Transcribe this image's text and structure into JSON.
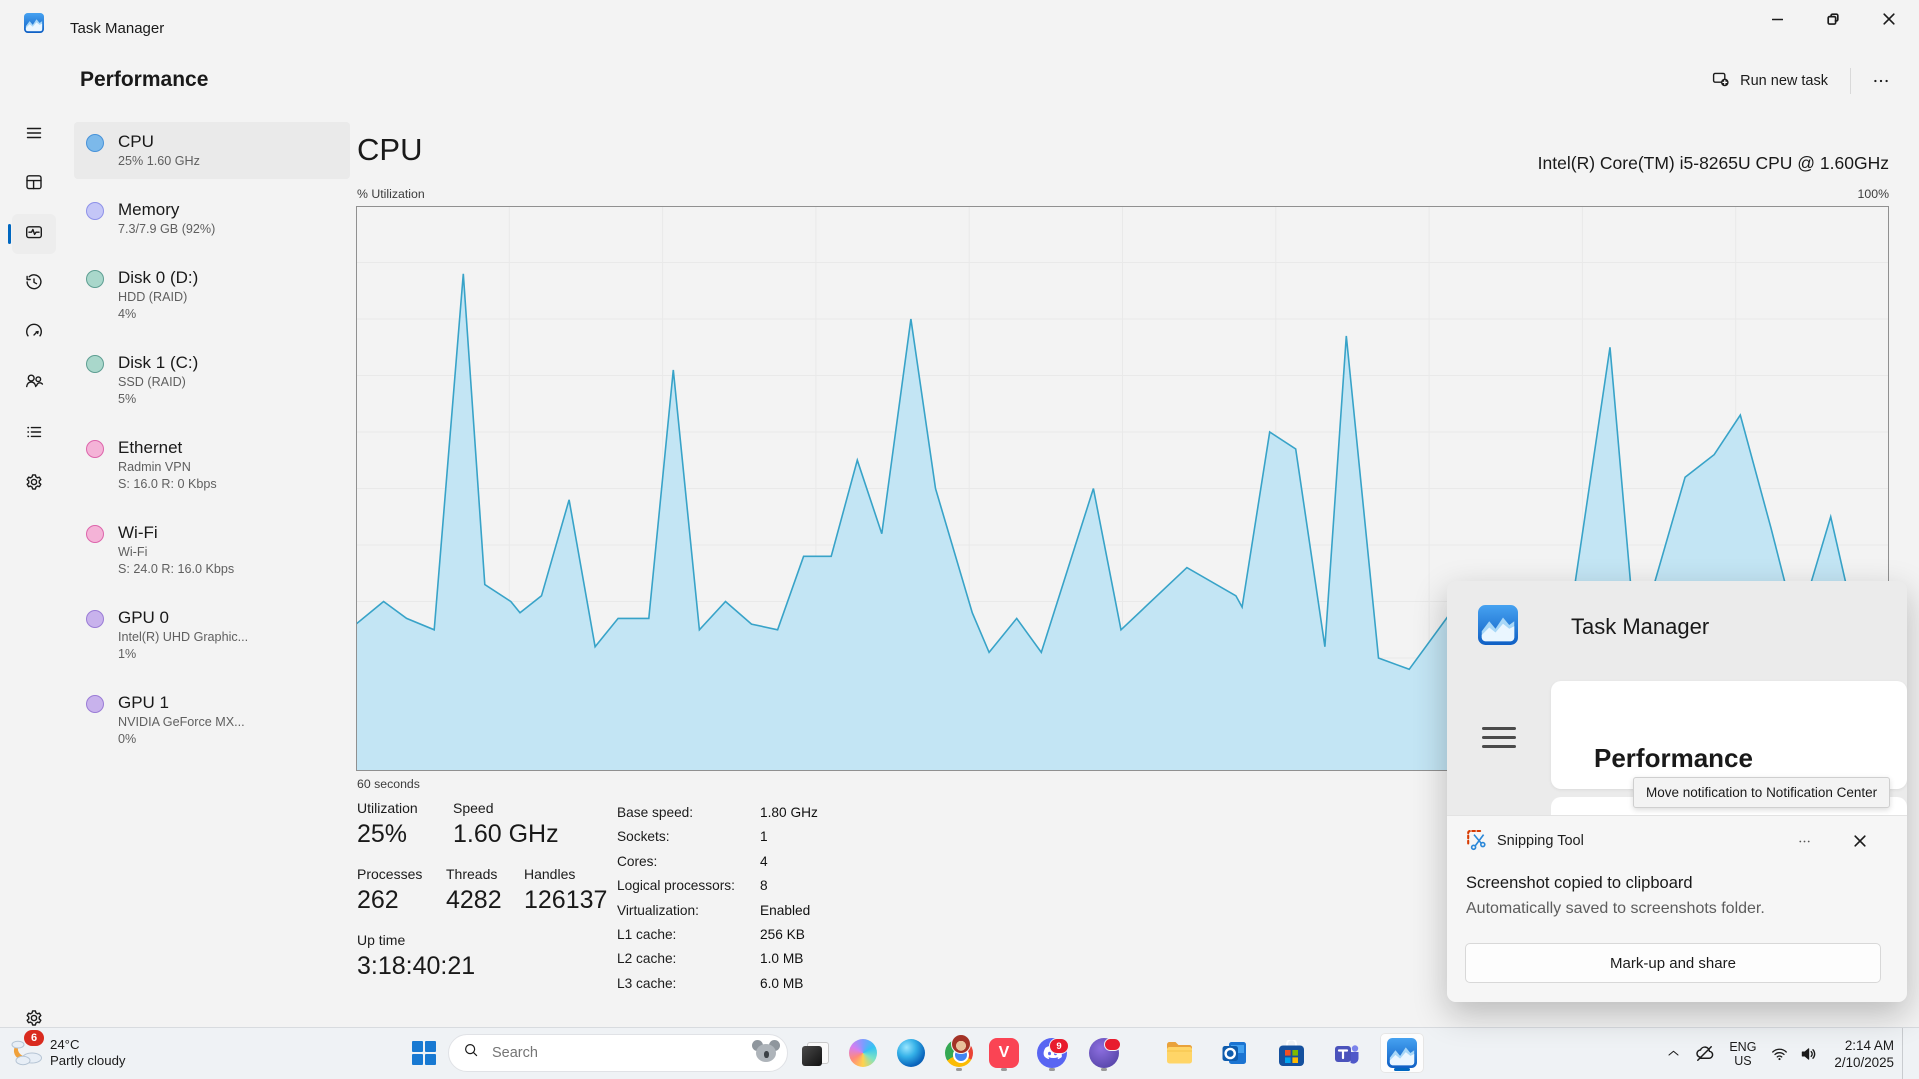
{
  "accent": "#0067c0",
  "window": {
    "title": "Task Manager"
  },
  "header": {
    "title": "Performance",
    "run_new_task": "Run new task"
  },
  "rail": {
    "items": [
      {
        "id": "hamburger",
        "name": "navigation-menu"
      },
      {
        "id": "processes",
        "name": "processes"
      },
      {
        "id": "performance",
        "name": "performance",
        "selected": true
      },
      {
        "id": "app-history",
        "name": "app-history"
      },
      {
        "id": "startup-apps",
        "name": "startup-apps"
      },
      {
        "id": "users",
        "name": "users"
      },
      {
        "id": "details",
        "name": "details"
      },
      {
        "id": "services",
        "name": "services"
      }
    ],
    "bottom": {
      "id": "settings",
      "name": "settings"
    }
  },
  "sidebar": {
    "items": [
      {
        "name": "CPU",
        "line2": "25% 1.60 GHz",
        "color": "cpu",
        "selected": true
      },
      {
        "name": "Memory",
        "line2": "7.3/7.9 GB (92%)",
        "color": "memory"
      },
      {
        "name": "Disk 0 (D:)",
        "line2": "HDD (RAID)",
        "line3": "4%",
        "color": "disk"
      },
      {
        "name": "Disk 1 (C:)",
        "line2": "SSD (RAID)",
        "line3": "5%",
        "color": "disk"
      },
      {
        "name": "Ethernet",
        "line2": "Radmin VPN",
        "line3": "S: 16.0 R: 0 Kbps",
        "color": "net"
      },
      {
        "name": "Wi-Fi",
        "line2": "Wi-Fi",
        "line3": "S: 24.0 R: 16.0 Kbps",
        "color": "net"
      },
      {
        "name": "GPU 0",
        "line2": "Intel(R) UHD Graphic...",
        "line3": "1%",
        "color": "gpu"
      },
      {
        "name": "GPU 1",
        "line2": "NVIDIA GeForce MX...",
        "line3": "0%",
        "color": "gpu"
      }
    ],
    "colors": {
      "cpu": {
        "fill": "#7cb9ea",
        "stroke": "#4792d9"
      },
      "memory": {
        "fill": "#c4c6f7",
        "stroke": "#8e91e9"
      },
      "disk": {
        "fill": "#a9d7cb",
        "stroke": "#5d9e92"
      },
      "net": {
        "fill": "#f4b3d7",
        "stroke": "#dd64ab"
      },
      "gpu": {
        "fill": "#c8b2ec",
        "stroke": "#9a7bd6"
      }
    }
  },
  "cpu": {
    "title": "CPU",
    "subtitle": "Intel(R) Core(TM) i5-8265U CPU @ 1.60GHz",
    "axis_top_left": "% Utilization",
    "axis_top_right": "100%",
    "axis_bottom_left": "60 seconds"
  },
  "stats": {
    "left": [
      [
        {
          "label": "Utilization",
          "value": "25%"
        },
        {
          "label": "Speed",
          "value": "1.60 GHz"
        }
      ],
      [
        {
          "label": "Processes",
          "value": "262"
        },
        {
          "label": "Threads",
          "value": "4282"
        },
        {
          "label": "Handles",
          "value": "126137"
        }
      ],
      [
        {
          "label": "Up time",
          "value": "3:18:40:21"
        }
      ]
    ],
    "right": [
      {
        "label": "Base speed:",
        "value": "1.80 GHz"
      },
      {
        "label": "Sockets:",
        "value": "1"
      },
      {
        "label": "Cores:",
        "value": "4"
      },
      {
        "label": "Logical processors:",
        "value": "8"
      },
      {
        "label": "Virtualization:",
        "value": "Enabled"
      },
      {
        "label": "L1 cache:",
        "value": "256 KB"
      },
      {
        "label": "L2 cache:",
        "value": "1.0 MB"
      },
      {
        "label": "L3 cache:",
        "value": "6.0 MB"
      }
    ]
  },
  "notification": {
    "thumb": {
      "app_title": "Task Manager",
      "page_title": "Performance"
    },
    "tooltip": "Move notification to Notification Center",
    "toast": {
      "app": "Snipping Tool",
      "title": "Screenshot copied to clipboard",
      "body": "Automatically saved to screenshots folder.",
      "action": "Mark-up and share"
    }
  },
  "taskbar": {
    "weather": {
      "temp": "24°C",
      "condition": "Partly cloudy",
      "badge": "6"
    },
    "search": {
      "placeholder": "Search"
    },
    "apps": [
      {
        "id": "task-view",
        "name": "task-view"
      },
      {
        "id": "copilot",
        "name": "copilot"
      },
      {
        "id": "edge",
        "name": "microsoft-edge"
      },
      {
        "id": "chrome",
        "name": "google-chrome",
        "running": true
      },
      {
        "id": "valorant",
        "name": "valorant",
        "running": true
      },
      {
        "id": "discord",
        "name": "discord",
        "badge": "9",
        "running": true
      },
      {
        "id": "avatar-app",
        "name": "pinned-app",
        "running": true,
        "badge_dot": true
      },
      {
        "id": "explorer",
        "name": "file-explorer"
      },
      {
        "id": "outlook",
        "name": "outlook"
      },
      {
        "id": "store",
        "name": "microsoft-store"
      },
      {
        "id": "teams",
        "name": "microsoft-teams"
      },
      {
        "id": "task-manager",
        "name": "task-manager",
        "active": true
      }
    ],
    "tray": {
      "lang_line1": "ENG",
      "lang_line2": "US",
      "time": "2:14 AM",
      "date": "2/10/2025"
    }
  },
  "chart_data": {
    "type": "area",
    "title": "CPU % Utilization over 60 seconds",
    "xlabel": "60 seconds",
    "ylabel": "% Utilization",
    "ylim": [
      0,
      100
    ],
    "x_range_seconds": 60,
    "grid": true,
    "legend": "none",
    "colors": {
      "line": "#38a3c8",
      "fill": "#bfe4f4",
      "grid": "#e9e9e9",
      "border": "#909090"
    },
    "points": [
      [
        0.0,
        26
      ],
      [
        0.018,
        30
      ],
      [
        0.033,
        27
      ],
      [
        0.051,
        25
      ],
      [
        0.07,
        88
      ],
      [
        0.084,
        33
      ],
      [
        0.101,
        30
      ],
      [
        0.107,
        28
      ],
      [
        0.121,
        31
      ],
      [
        0.139,
        48
      ],
      [
        0.156,
        22
      ],
      [
        0.171,
        27
      ],
      [
        0.191,
        27
      ],
      [
        0.207,
        71
      ],
      [
        0.224,
        25
      ],
      [
        0.241,
        30
      ],
      [
        0.258,
        26
      ],
      [
        0.275,
        25
      ],
      [
        0.292,
        38
      ],
      [
        0.31,
        38
      ],
      [
        0.327,
        55
      ],
      [
        0.343,
        42
      ],
      [
        0.362,
        80
      ],
      [
        0.378,
        50
      ],
      [
        0.402,
        28
      ],
      [
        0.413,
        21
      ],
      [
        0.431,
        27
      ],
      [
        0.447,
        21
      ],
      [
        0.481,
        50
      ],
      [
        0.499,
        25
      ],
      [
        0.542,
        36
      ],
      [
        0.574,
        31
      ],
      [
        0.578,
        29
      ],
      [
        0.596,
        60
      ],
      [
        0.613,
        57
      ],
      [
        0.632,
        22
      ],
      [
        0.646,
        77
      ],
      [
        0.667,
        20
      ],
      [
        0.687,
        18
      ],
      [
        0.714,
        28
      ],
      [
        0.734,
        18
      ],
      [
        0.766,
        33
      ],
      [
        0.788,
        20
      ],
      [
        0.818,
        75
      ],
      [
        0.835,
        22
      ],
      [
        0.867,
        52
      ],
      [
        0.886,
        56
      ],
      [
        0.903,
        63
      ],
      [
        0.923,
        43
      ],
      [
        0.94,
        25
      ],
      [
        0.962,
        45
      ],
      [
        0.983,
        20
      ],
      [
        1.0,
        28
      ]
    ]
  }
}
